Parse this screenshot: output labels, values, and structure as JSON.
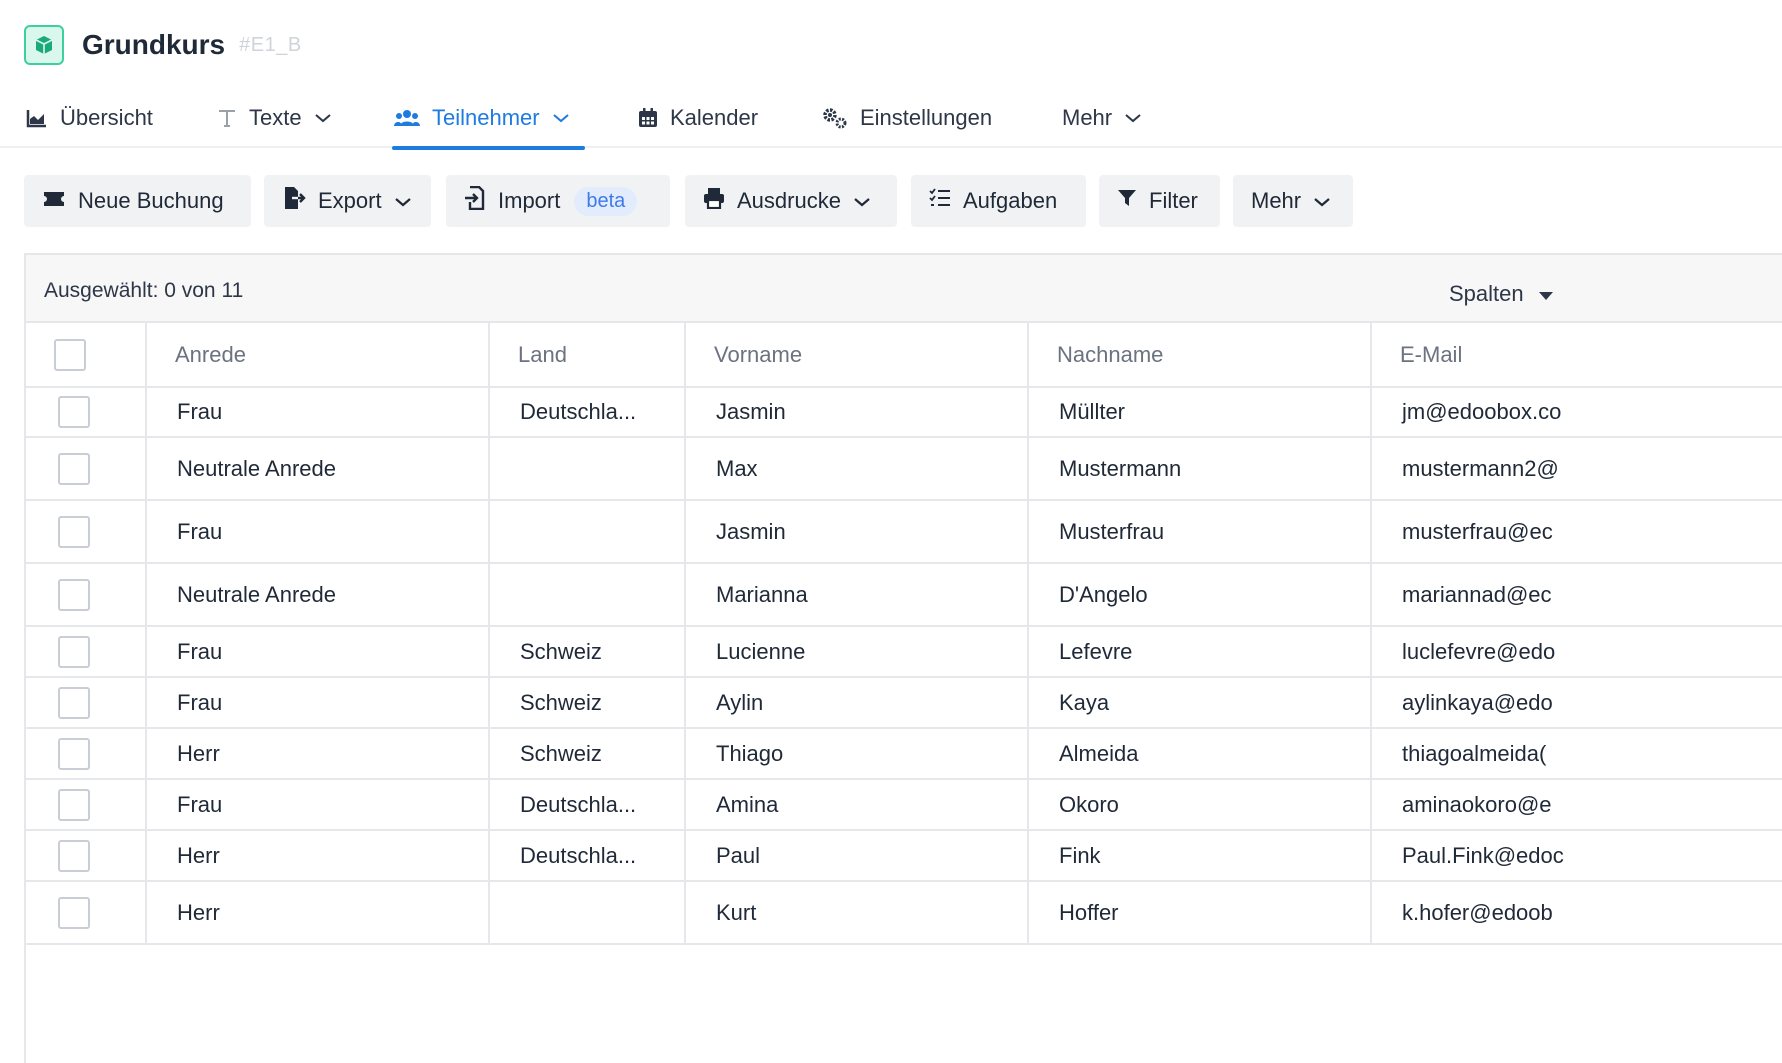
{
  "header": {
    "title": "Grundkurs",
    "code": "#E1_B"
  },
  "tabs": [
    {
      "label": "Übersicht",
      "icon": "chart-area-icon"
    },
    {
      "label": "Texte",
      "icon": "text-icon"
    },
    {
      "label": "Teilnehmer",
      "icon": "users-icon",
      "active": true
    },
    {
      "label": "Kalender",
      "icon": "calendar-icon"
    },
    {
      "label": "Einstellungen",
      "icon": "cogs-icon"
    },
    {
      "label": "Mehr",
      "icon": "chevron-down-icon"
    }
  ],
  "toolbar": {
    "neue_buchung": "Neue Buchung",
    "export": "Export",
    "import": "Import",
    "import_badge": "beta",
    "ausdrucke": "Ausdrucke",
    "aufgaben": "Aufgaben",
    "filter": "Filter",
    "mehr": "Mehr"
  },
  "table": {
    "selection": "Ausgewählt: 0 von 11",
    "columns_button": "Spalten",
    "headers": [
      "Anrede",
      "Land",
      "Vorname",
      "Nachname",
      "E-Mail"
    ],
    "rows": [
      [
        "Frau",
        "Deutschla...",
        "Jasmin",
        "Müllter",
        "jm@edoobox.co"
      ],
      [
        "Neutrale Anrede",
        "",
        "Max",
        "Mustermann",
        "mustermann2@"
      ],
      [
        "Frau",
        "",
        "Jasmin",
        "Musterfrau",
        "musterfrau@ec"
      ],
      [
        "Neutrale Anrede",
        "",
        "Marianna",
        "D'Angelo",
        "mariannad@ec"
      ],
      [
        "Frau",
        "Schweiz",
        "Lucienne",
        "Lefevre",
        "luclefevre@edo"
      ],
      [
        "Frau",
        "Schweiz",
        "Aylin",
        "Kaya",
        "aylinkaya@edo"
      ],
      [
        "Herr",
        "Schweiz",
        "Thiago",
        "Almeida",
        "thiagoalmeida("
      ],
      [
        "Frau",
        "Deutschla...",
        "Amina",
        "Okoro",
        "aminaokoro@e"
      ],
      [
        "Herr",
        "Deutschla...",
        "Paul",
        "Fink",
        "Paul.Fink@edoc"
      ],
      [
        "Herr",
        "",
        "Kurt",
        "Hoffer",
        "k.hofer@edoob"
      ]
    ]
  },
  "colors": {
    "accent": "#1e7be0",
    "logo": "#3ecf9e"
  }
}
